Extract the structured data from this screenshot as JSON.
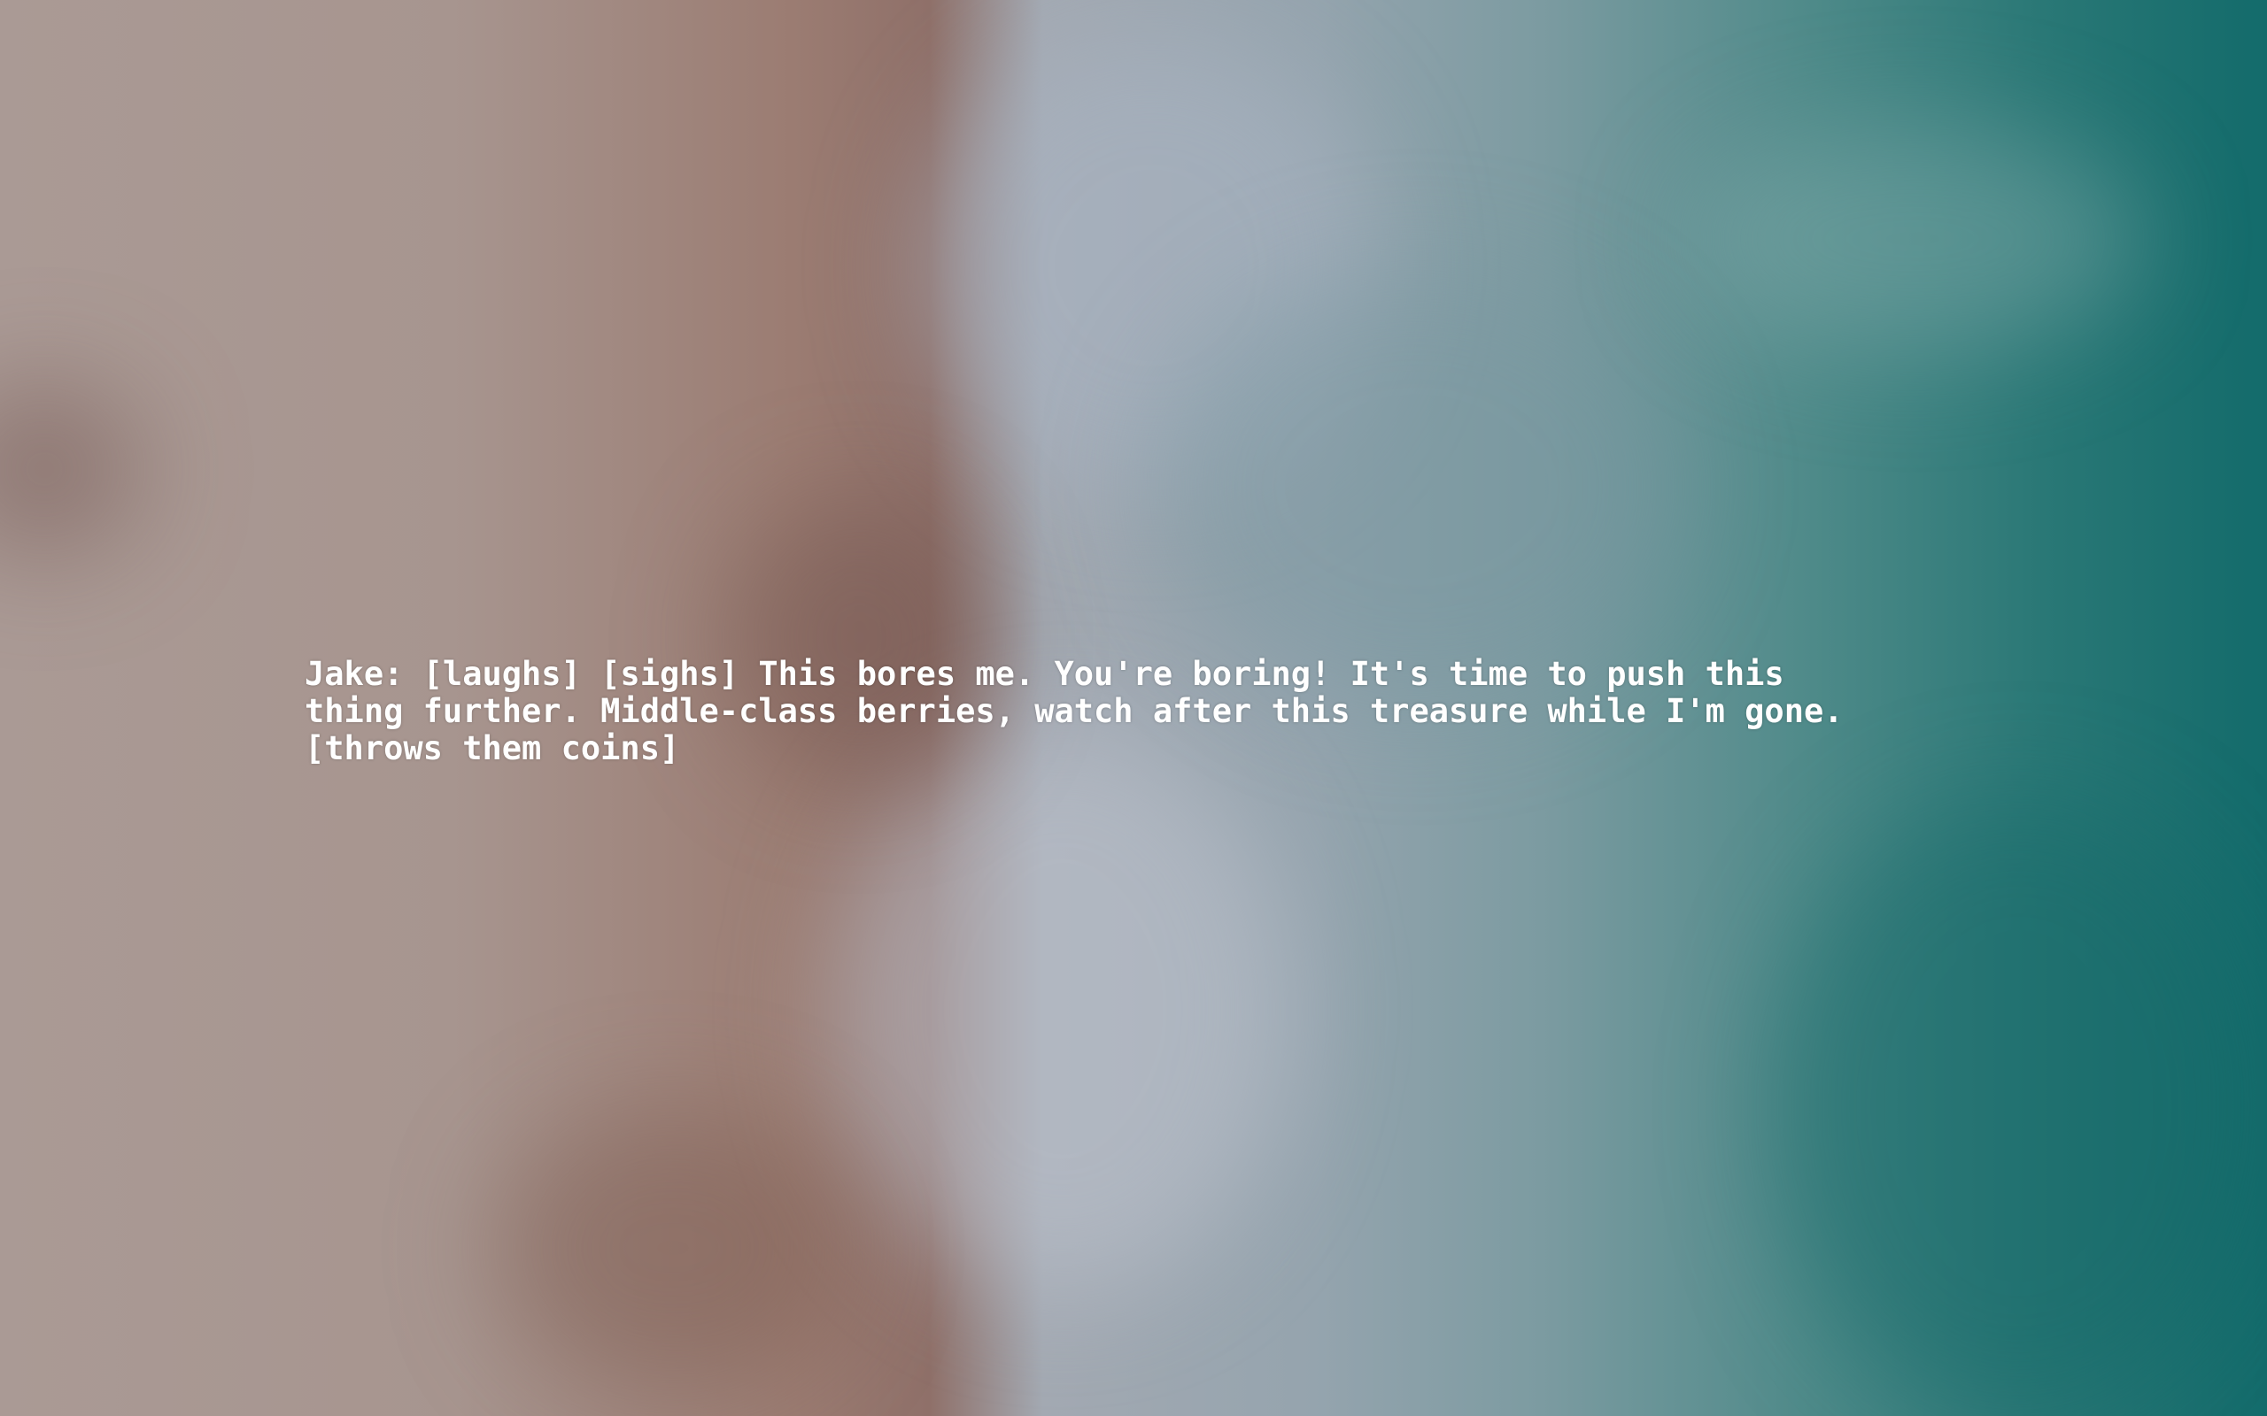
{
  "caption": {
    "text": "Jake: [laughs] [sighs] This bores me. You're boring! It's time to push this\nthing further. Middle-class berries, watch after this treasure while I'm gone.\n[throws them coins]"
  },
  "colors": {
    "caption_text": "#ffffff"
  }
}
